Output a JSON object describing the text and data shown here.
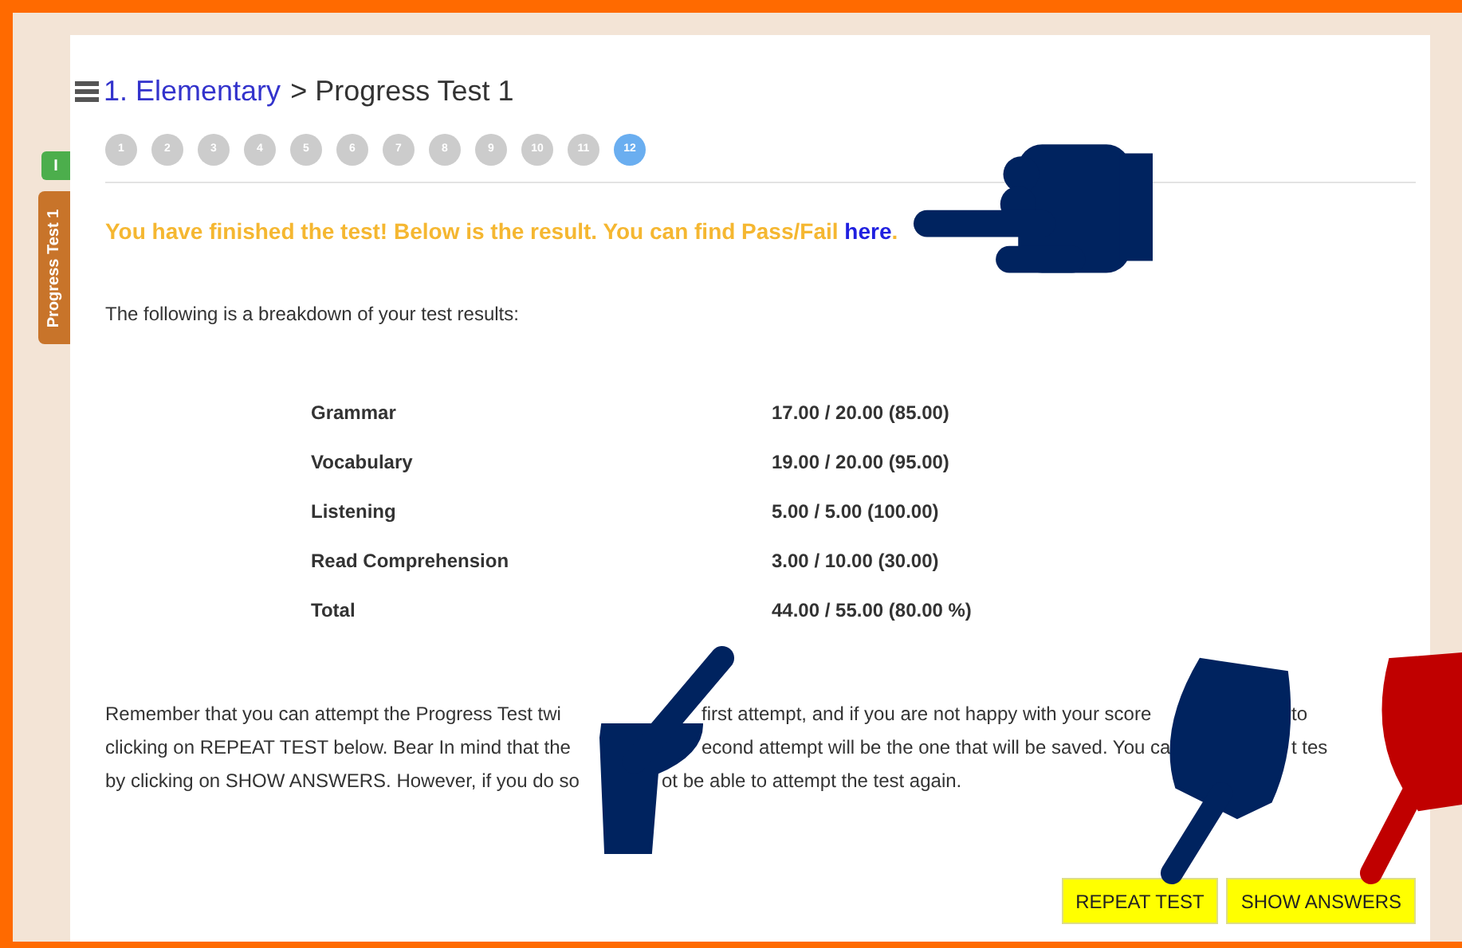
{
  "side_tabs": [
    {
      "label": "I",
      "color": "#4cae4c"
    },
    {
      "label": "Progress Test 1",
      "color": "#c8742a"
    }
  ],
  "breadcrumb": {
    "parent": "1. Elementary",
    "separator": ">",
    "current": "Progress Test 1"
  },
  "steps": [
    {
      "label": "1",
      "selected": false
    },
    {
      "label": "2",
      "selected": false
    },
    {
      "label": "3",
      "selected": false
    },
    {
      "label": "4",
      "selected": false
    },
    {
      "label": "5",
      "selected": false
    },
    {
      "label": "6",
      "selected": false
    },
    {
      "label": "7",
      "selected": false
    },
    {
      "label": "8",
      "selected": false
    },
    {
      "label": "9",
      "selected": false
    },
    {
      "label": "10",
      "selected": false
    },
    {
      "label": "11",
      "selected": false
    },
    {
      "label": "12",
      "selected": true
    }
  ],
  "message": {
    "text": "You have finished the test! Below is the result. You can find Pass/Fail",
    "link": "here",
    "end": "."
  },
  "intro": "The following is a breakdown of your test results:",
  "results": [
    {
      "label": "Grammar",
      "score": "17.00 / 20.00 (85.00)"
    },
    {
      "label": "Vocabulary",
      "score": "19.00 / 20.00 (95.00)"
    },
    {
      "label": "Listening",
      "score": "5.00 / 5.00 (100.00)"
    },
    {
      "label": "Read Comprehension",
      "score": "3.00 / 10.00 (30.00)"
    },
    {
      "label": "Total",
      "score": "44.00 / 55.00 (80.00 %)"
    }
  ],
  "notice_lines": [
    [
      "Remember that you can attempt the Progress Test twi",
      "first attempt, and if you are not happy with your score",
      "to"
    ],
    [
      "clicking on REPEAT TEST below. Bear In mind that the",
      "econd attempt will be the one that will be saved. You ca",
      "t tes"
    ],
    [
      "by clicking on SHOW ANSWERS. However, if you do so",
      "ot be able to attempt the test again."
    ]
  ],
  "buttons": [
    "REPEAT TEST",
    "SHOW ANSWERS"
  ]
}
